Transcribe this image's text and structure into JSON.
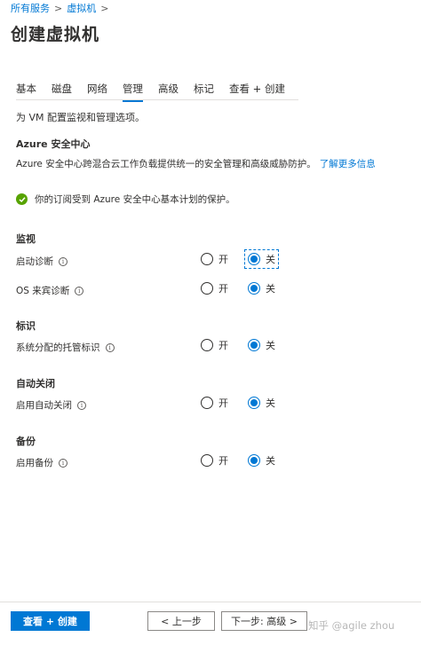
{
  "breadcrumb": {
    "items": [
      "所有服务",
      "虚拟机"
    ],
    "separator": ">"
  },
  "page_title": "创建虚拟机",
  "tabs": [
    "基本",
    "磁盘",
    "网络",
    "管理",
    "高级",
    "标记",
    "查看 + 创建"
  ],
  "active_tab": "管理",
  "intro": "为 VM 配置监视和管理选项。",
  "security": {
    "title": "Azure 安全中心",
    "description": "Azure 安全中心跨混合云工作负载提供统一的安全管理和高级威胁防护。",
    "link": "了解更多信息",
    "notice": "你的订阅受到 Azure 安全中心基本计划的保护。"
  },
  "radio_labels": {
    "on": "开",
    "off": "关"
  },
  "sections": {
    "monitoring": {
      "title": "监视",
      "boot_diagnostics": {
        "label": "启动诊断",
        "value": "关"
      },
      "os_guest_diagnostics": {
        "label": "OS 来宾诊断",
        "value": "关"
      }
    },
    "identity": {
      "title": "标识",
      "managed_identity": {
        "label": "系统分配的托管标识",
        "value": "关"
      }
    },
    "auto_shutdown": {
      "title": "自动关闭",
      "enable": {
        "label": "启用自动关闭",
        "value": "关"
      }
    },
    "backup": {
      "title": "备份",
      "enable": {
        "label": "启用备份",
        "value": "关"
      }
    }
  },
  "footer": {
    "review_create": "查看 + 创建",
    "previous": "< 上一步",
    "next": "下一步: 高级 >"
  },
  "watermark": "知乎 @agile zhou",
  "colors": {
    "accent": "#0078d4",
    "success": "#57a300"
  }
}
